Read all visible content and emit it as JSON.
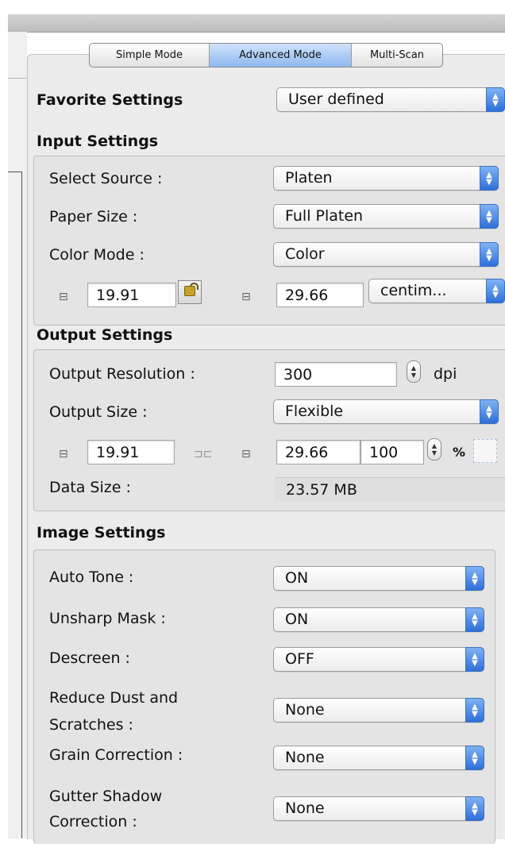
{
  "tabs": [
    {
      "label": "Simple Mode"
    },
    {
      "label": "Advanced Mode"
    },
    {
      "label": "Multi-Scan"
    }
  ],
  "favorite": {
    "label": "Favorite Settings",
    "value": "User defined"
  },
  "input": {
    "header": "Input Settings",
    "source_label": "Select Source :",
    "source_value": "Platen",
    "paper_label": "Paper Size :",
    "paper_value": "Full Platen",
    "color_label": "Color Mode :",
    "color_value": "Color",
    "width": "19.91",
    "height": "29.66",
    "unit": "centim..."
  },
  "output": {
    "header": "Output Settings",
    "resolution_label": "Output Resolution :",
    "resolution_value": "300",
    "resolution_unit": "dpi",
    "size_label": "Output Size :",
    "size_value": "Flexible",
    "width": "19.91",
    "height": "29.66",
    "scale": "100",
    "percent": "%",
    "datasize_label": "Data Size :",
    "datasize_value": "23.57 MB"
  },
  "image": {
    "header": "Image Settings",
    "rows": [
      {
        "label": "Auto Tone :",
        "value": "ON"
      },
      {
        "label": "Unsharp Mask :",
        "value": "ON"
      },
      {
        "label": "Descreen :",
        "value": "OFF"
      },
      {
        "label1": "Reduce Dust and",
        "label2": "Scratches :",
        "value": "None"
      },
      {
        "label": "Grain Correction :",
        "value": "None"
      },
      {
        "label1": "Gutter Shadow",
        "label2": "Correction :",
        "value": "None"
      }
    ]
  },
  "colors": {
    "accent": "#2f6fd9",
    "tab_active": "#a9c8f3",
    "panel": "#ececec"
  }
}
